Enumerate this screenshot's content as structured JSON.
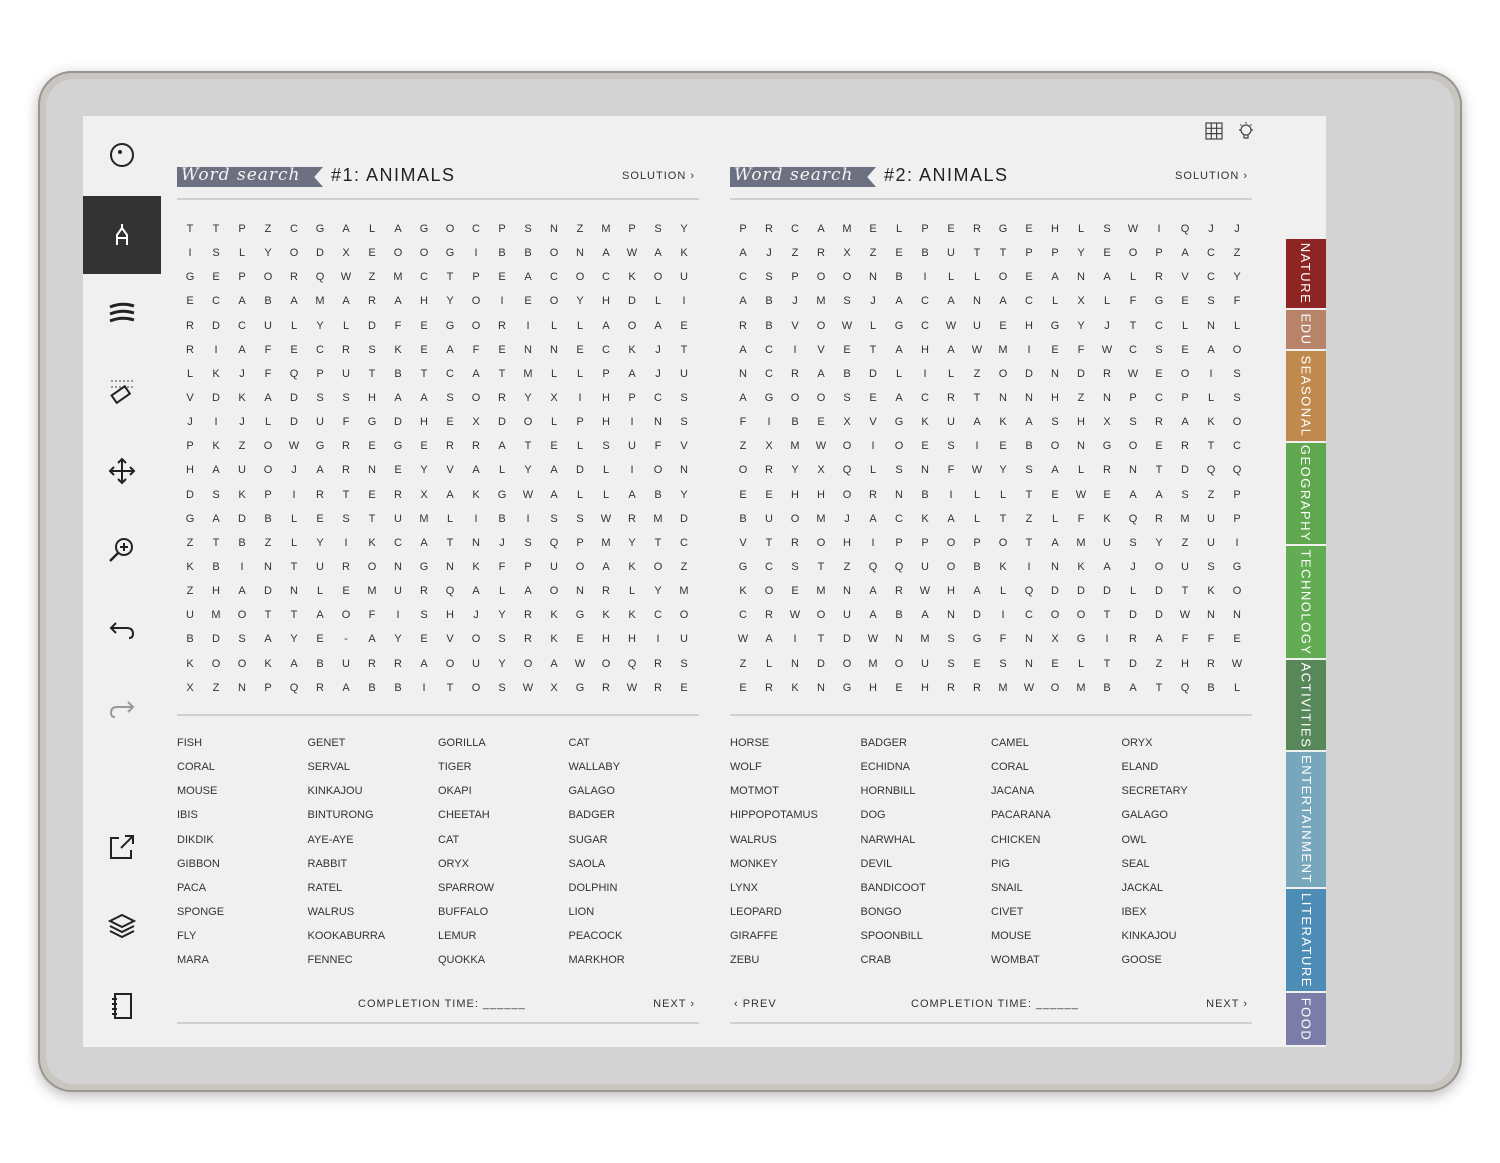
{
  "top_icons": [
    "grid-icon",
    "lightbulb-icon"
  ],
  "toolbar": [
    "circle-dot-icon",
    "pen-icon",
    "lines-icon",
    "eraser-icon",
    "move-icon",
    "zoom-icon",
    "undo-icon",
    "redo-icon",
    "export-icon",
    "layers-icon",
    "notebook-icon"
  ],
  "pages": [
    {
      "banner": "Word search",
      "title": "#1: ANIMALS",
      "solution": "SOLUTION ›",
      "grid": [
        "TTPZCGALAGOCPSNZMPSY",
        "ISLYODXEOOGIBBONAWAK",
        "GEPORQWZMCTPEACOCKOU",
        "ECABAMARAHYOIEOYHDLI",
        "RDCULYLDFEGORILLAOAE",
        "RIAFECRSKEAFENNECKJT",
        "LKJFQPUTBTCATMLLPAJU",
        "VDKADSSHAASORYXIHPCS",
        "JIJLDUFGDHEXDOLPHINS",
        "PKZOWGREGERRATELSUFV",
        "HAUOJARNEYVALYADLION",
        "DSKPIRTERXAKGWALLABY",
        "GADBLESTUMLIBISSWRMD",
        "ZTBZLYIKCATNJSQPMYTC",
        "KBINTURONGNKFPUOAKOZ",
        "ZHADNLEMURQALAONRLYM",
        "UMOTTAOFISHJYRKGKKCO",
        "BDSAYE-AYEVOSRKEHHIU",
        "KOOKABURRAOUYOAWOQRS",
        "XZNPQRABBITOSWXGRWRE"
      ],
      "words": [
        [
          "FISH",
          "CORAL",
          "MOUSE",
          "IBIS",
          "DIKDIK",
          "GIBBON",
          "PACA",
          "SPONGE",
          "FLY",
          "MARA"
        ],
        [
          "GENET",
          "SERVAL",
          "KINKAJOU",
          "BINTURONG",
          "AYE-AYE",
          "RABBIT",
          "RATEL",
          "WALRUS",
          "KOOKABURRA",
          "FENNEC"
        ],
        [
          "GORILLA",
          "TIGER",
          "OKAPI",
          "CHEETAH",
          "CAT",
          "ORYX",
          "SPARROW",
          "BUFFALO",
          "LEMUR",
          "QUOKKA"
        ],
        [
          "CAT",
          "WALLABY",
          "GALAGO",
          "BADGER",
          "SUGAR",
          "SAOLA",
          "DOLPHIN",
          "LION",
          "PEACOCK",
          "MARKHOR"
        ]
      ],
      "completion": "COMPLETION TIME: ______",
      "prev": "",
      "next": "NEXT ›"
    },
    {
      "banner": "Word search",
      "title": "#2: ANIMALS",
      "solution": "SOLUTION ›",
      "grid": [
        "PRCAMELPERGEHLSWIQJJ",
        "AJZRXZEBUTTPPYEOPACZ",
        "CSPOONBILLOEANALRVCY",
        "ABJMSJACANACLXLFGESF",
        "RBVOWLGCWUEHGYJTCLNL",
        "ACIVETAHAWMIEFWCSEAO",
        "NCRABDLILZODNDRWEOIS",
        "AGOOSEACRTNNHZNPCPLS",
        "FIBEXVGKUAKASHXSRAKO",
        "ZXMWOIOESIEBONGOERTC",
        "ORYXQLSNFWYSALRNTDQQ",
        "EEHHORNBILLTEWEAASZP",
        "BUOMJACKALTZLFKQRMUP",
        "VTROHIPPOPOTAMUSYZUI",
        "GCSTZQQUOBKINKAJOUSG",
        "KOEMNARWHALQDDDLDTKO",
        "CRWOUABANDICOOTDDWNN",
        "WAITDWNMSGFNXGIRAFFE",
        "ZLNDOMOUSESNELTDZHRW",
        "ERKNGHEHRRMWOMBATQBL"
      ],
      "words": [
        [
          "HORSE",
          "WOLF",
          "MOTMOT",
          "HIPPOPOTAMUS",
          "WALRUS",
          "MONKEY",
          "LYNX",
          "LEOPARD",
          "GIRAFFE",
          "ZEBU"
        ],
        [
          "BADGER",
          "ECHIDNA",
          "HORNBILL",
          "DOG",
          "NARWHAL",
          "DEVIL",
          "BANDICOOT",
          "BONGO",
          "SPOONBILL",
          "CRAB"
        ],
        [
          "CAMEL",
          "CORAL",
          "JACANA",
          "PACARANA",
          "CHICKEN",
          "PIG",
          "SNAIL",
          "CIVET",
          "MOUSE",
          "WOMBAT"
        ],
        [
          "ORYX",
          "ELAND",
          "SECRETARY",
          "GALAGO",
          "OWL",
          "SEAL",
          "JACKAL",
          "IBEX",
          "KINKAJOU",
          "GOOSE"
        ]
      ],
      "completion": "COMPLETION TIME: ______",
      "prev": "‹  PREV",
      "next": "NEXT ›"
    }
  ],
  "tabs": [
    {
      "label": "NATURE",
      "color": "#8e2424"
    },
    {
      "label": "EDU",
      "color": "#b7846a"
    },
    {
      "label": "SEASONAL",
      "color": "#c08a4e"
    },
    {
      "label": "GEOGRAPHY",
      "color": "#5fa84f"
    },
    {
      "label": "TECHNOLOGY",
      "color": "#62ac54"
    },
    {
      "label": "ACTIVITIES",
      "color": "#58885a"
    },
    {
      "label": "ENTERTAINMENT",
      "color": "#78a6bd"
    },
    {
      "label": "LITERATURE",
      "color": "#4d8cb5"
    },
    {
      "label": "FOOD",
      "color": "#7c7ca8"
    }
  ]
}
